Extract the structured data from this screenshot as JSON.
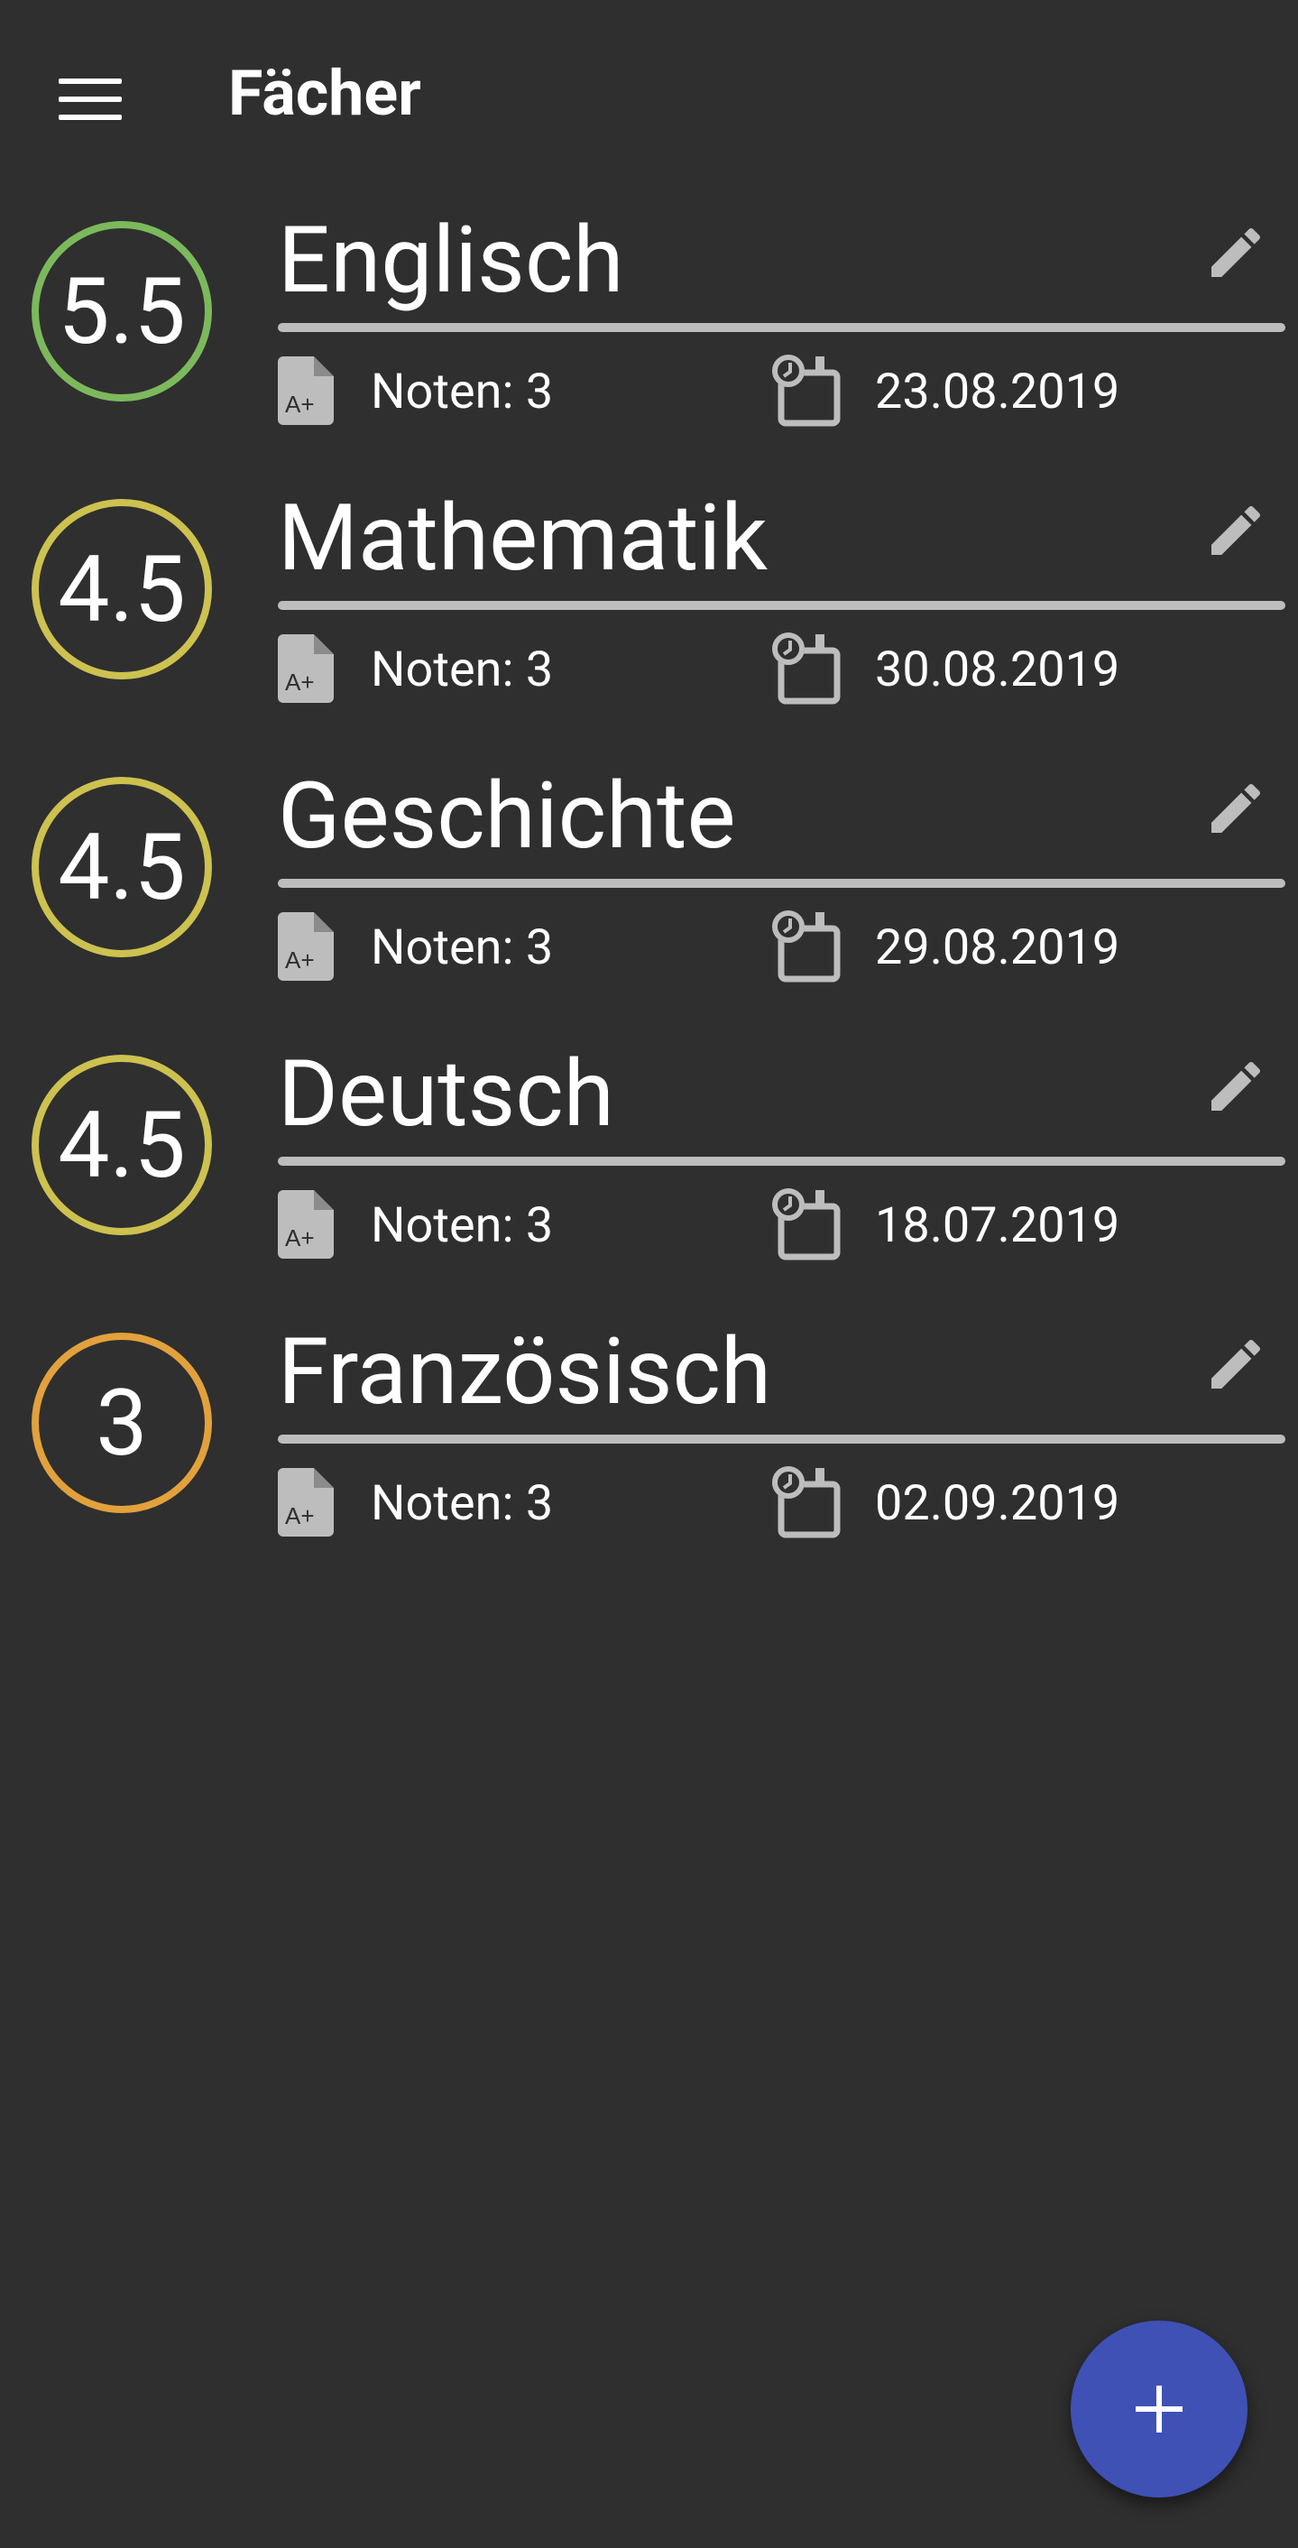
{
  "app_bar": {
    "title": "Fächer",
    "menu_icon": "hamburger-menu-icon"
  },
  "subjects": [
    {
      "name": "Englisch",
      "grade": "5.5",
      "color": "#7cb95c",
      "grades_label": "Noten: 3",
      "date": "23.08.2019"
    },
    {
      "name": "Mathematik",
      "grade": "4.5",
      "color": "#cdc150",
      "grades_label": "Noten: 3",
      "date": "30.08.2019"
    },
    {
      "name": "Geschichte",
      "grade": "4.5",
      "color": "#cdc150",
      "grades_label": "Noten: 3",
      "date": "29.08.2019"
    },
    {
      "name": "Deutsch",
      "grade": "4.5",
      "color": "#cdc150",
      "grades_label": "Noten: 3",
      "date": "18.07.2019"
    },
    {
      "name": "Französisch",
      "grade": "3",
      "color": "#e2a13c",
      "grades_label": "Noten: 3",
      "date": "02.09.2019"
    }
  ],
  "icons": {
    "edit": "pencil-icon",
    "grades": "grade-document-icon",
    "date": "clock-calendar-icon",
    "fab": "plus-icon"
  },
  "colors": {
    "background": "#2f2f2f",
    "fab": "#3f51b5",
    "divider": "#bdbdbd",
    "icon": "#bdbdbd"
  }
}
